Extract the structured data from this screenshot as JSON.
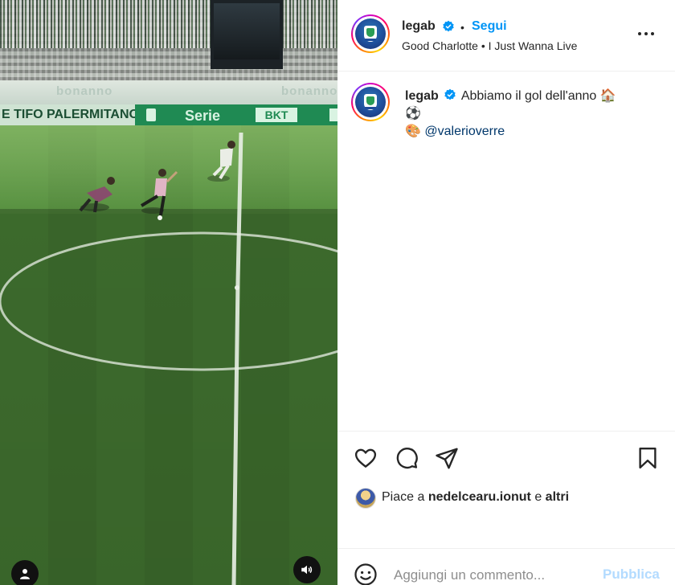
{
  "video": {
    "board_tifo_text": "E TIFO PALERMITANO",
    "board_serie_text": "Serie",
    "board_sponsor_text": "BKT",
    "ad_text_left": "bonanno",
    "ad_text_right": "bonanno",
    "profile_icon": "person-icon",
    "audio_icon": "speaker-icon"
  },
  "header": {
    "username": "legab",
    "verified_icon": "verified-badge-icon",
    "separator": "•",
    "follow_label": "Segui",
    "audio_track": "Good Charlotte • I Just Wanna Live",
    "more_icon": "more-options-icon"
  },
  "caption": {
    "username": "legab",
    "text_line1": "Abbiamo il gol dell'anno 🏠",
    "text_line2": "⚽",
    "emoji_prefix": "🎨",
    "mention": "@valerioverre"
  },
  "actions": {
    "like_icon": "heart-icon",
    "comment_icon": "comment-icon",
    "share_icon": "send-icon",
    "save_icon": "bookmark-icon"
  },
  "likes": {
    "prefix": "Piace a",
    "user": "nedelcearu.ionut",
    "connector": "e",
    "others": "altri"
  },
  "comment": {
    "placeholder": "Aggiungi un commento...",
    "publish_label": "Pubblica",
    "emoji_icon": "smiley-icon"
  },
  "colors": {
    "accent": "#0095f6",
    "publish_disabled": "#b3dbff",
    "mention": "#00376b"
  }
}
